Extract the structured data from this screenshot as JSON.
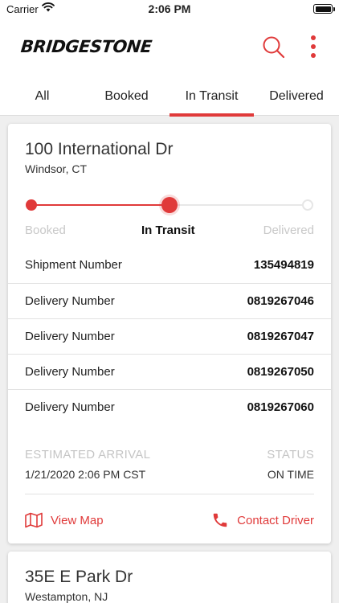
{
  "status_bar": {
    "carrier": "Carrier",
    "time": "2:06 PM"
  },
  "header": {
    "logo": "BRIDGESTONE"
  },
  "tabs": [
    {
      "label": "All"
    },
    {
      "label": "Booked"
    },
    {
      "label": "In Transit"
    },
    {
      "label": "Delivered"
    }
  ],
  "active_tab": "In Transit",
  "colors": {
    "accent": "#e03a3a",
    "muted": "#c8c8c8",
    "background": "#efefef"
  },
  "shipments": [
    {
      "address": "100 International Dr",
      "city": "Windsor, CT",
      "progress": {
        "steps": [
          "Booked",
          "In Transit",
          "Delivered"
        ],
        "current_step": "In Transit",
        "fraction_complete": 0.5
      },
      "rows": [
        {
          "label": "Shipment Number",
          "value": "135494819"
        },
        {
          "label": "Delivery Number",
          "value": "0819267046"
        },
        {
          "label": "Delivery Number",
          "value": "0819267047"
        },
        {
          "label": "Delivery Number",
          "value": "0819267050"
        },
        {
          "label": "Delivery Number",
          "value": "0819267060"
        }
      ],
      "estimated_arrival_label": "ESTIMATED ARRIVAL",
      "estimated_arrival": "1/21/2020 2:06 PM CST",
      "status_label": "STATUS",
      "status": "ON TIME",
      "view_map_label": "View Map",
      "contact_driver_label": "Contact Driver"
    },
    {
      "address": "35E E Park Dr",
      "city": "Westampton, NJ"
    }
  ]
}
